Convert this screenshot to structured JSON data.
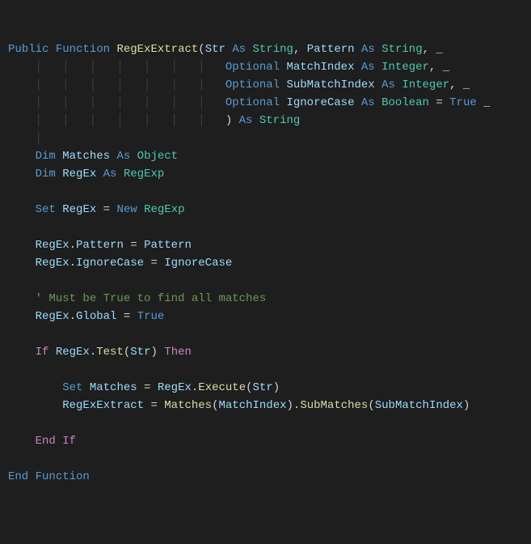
{
  "code": {
    "l1": {
      "kw1": "Public",
      "kw2": "Function",
      "fn": "RegExExtract",
      "p1": "Str",
      "kw_as1": "As",
      "type1": "String",
      "comma1": ", ",
      "p2": "Pattern",
      "kw_as2": "As",
      "type2": "String",
      "cont": ", _"
    },
    "l2": {
      "kw": "Optional",
      "p": "MatchIndex",
      "kw_as": "As",
      "type": "Integer",
      "cont": ", _"
    },
    "l3": {
      "kw": "Optional",
      "p": "SubMatchIndex",
      "kw_as": "As",
      "type": "Integer",
      "cont": ", _"
    },
    "l4": {
      "kw": "Optional",
      "p": "IgnoreCase",
      "kw_as": "As",
      "type": "Boolean",
      "eq": " = ",
      "val": "True",
      "cont": " _"
    },
    "l5": {
      "close": ")",
      "kw_as": "As",
      "type": "String"
    },
    "l7": {
      "kw": "Dim",
      "v": "Matches",
      "kw_as": "As",
      "type": "Object"
    },
    "l8": {
      "kw": "Dim",
      "v": "RegEx",
      "kw_as": "As",
      "type": "RegExp"
    },
    "l10": {
      "kw": "Set",
      "v": "RegEx",
      "eq": " = ",
      "kw_new": "New",
      "type": "RegExp"
    },
    "l12": {
      "o": "RegEx",
      "dot": ".",
      "p": "Pattern",
      "eq": " = ",
      "v": "Pattern"
    },
    "l13": {
      "o": "RegEx",
      "dot": ".",
      "p": "IgnoreCase",
      "eq": " = ",
      "v": "IgnoreCase"
    },
    "l15": {
      "cmt": "' Must be True to find all matches"
    },
    "l16": {
      "o": "RegEx",
      "dot": ".",
      "p": "Global",
      "eq": " = ",
      "v": "True"
    },
    "l18": {
      "kw_if": "If",
      "o": "RegEx",
      "dot": ".",
      "fn": "Test",
      "arg": "Str",
      "kw_then": "Then"
    },
    "l20": {
      "kw": "Set",
      "v": "Matches",
      "eq": " = ",
      "o": "RegEx",
      "dot": ".",
      "fn": "Execute",
      "arg": "Str"
    },
    "l21": {
      "v": "RegExExtract",
      "eq": " = ",
      "o": "Matches",
      "arg1": "MatchIndex",
      "dot": ".",
      "fn": "SubMatches",
      "arg2": "SubMatchIndex"
    },
    "l23": {
      "kw": "End",
      "kw2": "If"
    },
    "l25": {
      "kw": "End",
      "kw2": "Function"
    }
  }
}
